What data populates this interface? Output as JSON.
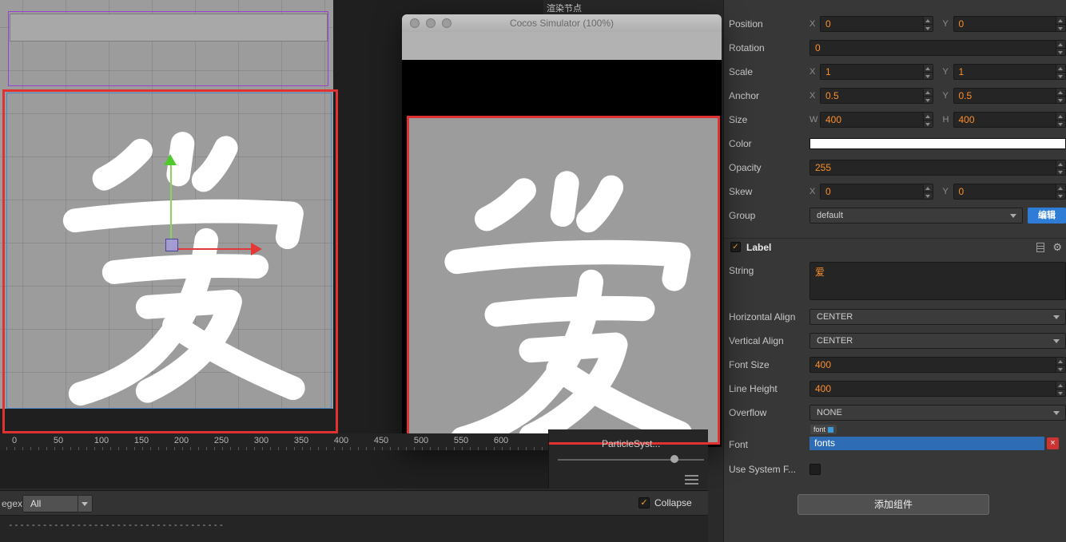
{
  "icons": {
    "check": "✓",
    "close": "×",
    "gear": "⚙"
  },
  "axis": {
    "x": "X",
    "y": "Y",
    "w": "W",
    "h": "H"
  },
  "hierarchy": {
    "tab": "渲染节点"
  },
  "scene": {
    "ruler": [
      "0",
      "50",
      "100",
      "150",
      "200",
      "250",
      "300",
      "350",
      "400",
      "450",
      "500",
      "550",
      "600"
    ],
    "character": "爱"
  },
  "simulator": {
    "title": "Cocos Simulator (100%)",
    "character": "爱"
  },
  "bottom_panel": {
    "item": "ParticleSyst..."
  },
  "console": {
    "regex_label": "egex",
    "filter_value": "All",
    "collapse_label": "Collapse",
    "output_line": "--------------------------------------"
  },
  "inspector": {
    "position": {
      "label": "Position",
      "x": "0",
      "y": "0"
    },
    "rotation": {
      "label": "Rotation",
      "value": "0"
    },
    "scale": {
      "label": "Scale",
      "x": "1",
      "y": "1"
    },
    "anchor": {
      "label": "Anchor",
      "x": "0.5",
      "y": "0.5"
    },
    "size": {
      "label": "Size",
      "w": "400",
      "h": "400"
    },
    "color": {
      "label": "Color",
      "value": "#FFFFFF"
    },
    "opacity": {
      "label": "Opacity",
      "value": "255"
    },
    "skew": {
      "label": "Skew",
      "x": "0",
      "y": "0"
    },
    "group": {
      "label": "Group",
      "value": "default",
      "edit_button": "编辑"
    },
    "label_section": {
      "title": "Label"
    },
    "string": {
      "label": "String",
      "value": "爱"
    },
    "h_align": {
      "label": "Horizontal Align",
      "value": "CENTER"
    },
    "v_align": {
      "label": "Vertical Align",
      "value": "CENTER"
    },
    "font_size": {
      "label": "Font Size",
      "value": "400"
    },
    "line_height": {
      "label": "Line Height",
      "value": "400"
    },
    "overflow": {
      "label": "Overflow",
      "value": "NONE"
    },
    "font": {
      "label": "Font",
      "chip": "font",
      "value": "fonts"
    },
    "use_system": {
      "label": "Use System F..."
    },
    "add_component": "添加组件"
  }
}
